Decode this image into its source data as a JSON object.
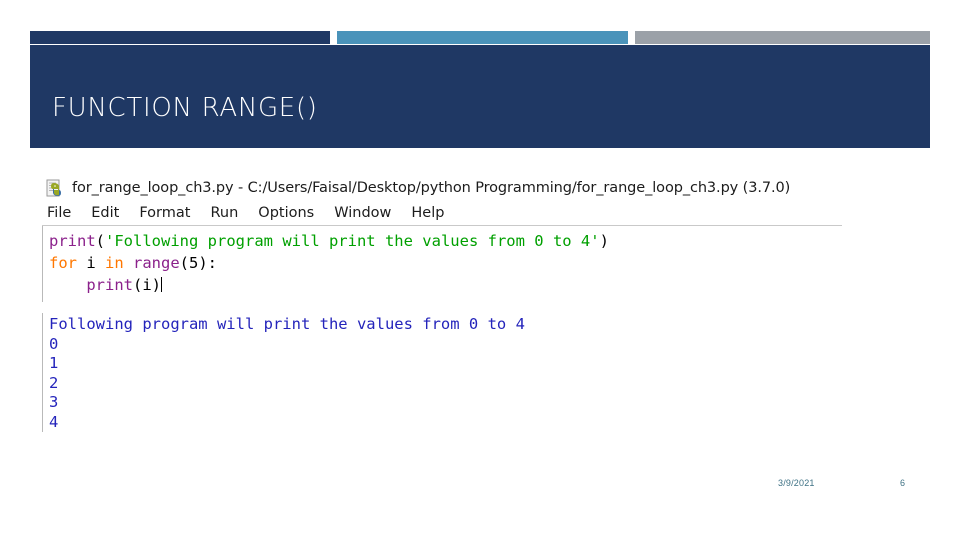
{
  "slide": {
    "title": "FUNCTION RANGE()",
    "accent_navy": "#1f3864",
    "accent_blue": "#4a93ba",
    "accent_gray": "#9ba1a8"
  },
  "idle_window": {
    "icon_name": "python-file-icon",
    "title": "for_range_loop_ch3.py - C:/Users/Faisal/Desktop/python Programming/for_range_loop_ch3.py (3.7.0)",
    "menu": [
      {
        "label": "File"
      },
      {
        "label": "Edit"
      },
      {
        "label": "Format"
      },
      {
        "label": "Run"
      },
      {
        "label": "Options"
      },
      {
        "label": "Window"
      },
      {
        "label": "Help"
      }
    ],
    "code": {
      "line1": {
        "func": "print",
        "open_paren": "(",
        "string": "'Following program will print the values from 0 to 4'",
        "close_paren": ")"
      },
      "line2": {
        "kw_for": "for",
        "var": " i ",
        "kw_in": "in",
        "func": " range",
        "args": "(5):"
      },
      "line3": {
        "indent": "    ",
        "func": "print",
        "args": "(i)"
      }
    }
  },
  "shell_output": {
    "lines": [
      "Following program will print the values from 0 to 4",
      "0",
      "1",
      "2",
      "3",
      "4"
    ]
  },
  "footer": {
    "date": "3/9/2021",
    "page_number": "6"
  }
}
